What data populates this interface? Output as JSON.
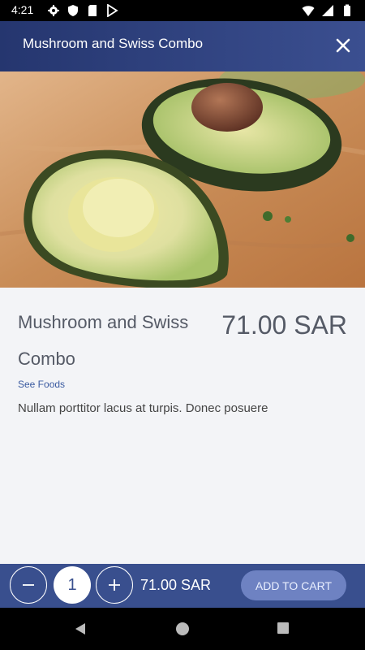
{
  "status_bar": {
    "time": "4:21",
    "left_icons": [
      "settings-icon",
      "shield-icon",
      "sdcard-icon",
      "play-store-icon"
    ],
    "right_icons": [
      "wifi-icon",
      "signal-icon",
      "battery-icon"
    ]
  },
  "app_bar": {
    "title": "Mushroom and Swiss Combo",
    "close_icon": "close-icon"
  },
  "product": {
    "name": "Mushroom and Swiss Combo",
    "price": "71.00 SAR",
    "link_label": "See Foods",
    "description": "Nullam porttitor lacus at turpis. Donec posuere"
  },
  "cart_bar": {
    "quantity": "1",
    "total": "71.00 SAR",
    "add_to_cart_label": "ADD TO CART"
  },
  "nav_bar": {
    "buttons": [
      "back-icon",
      "home-icon",
      "recents-icon"
    ]
  },
  "colors": {
    "app_bar": "#2e3f7c",
    "action_bar": "#394f8e",
    "add_to_cart": "#6e82c2"
  }
}
